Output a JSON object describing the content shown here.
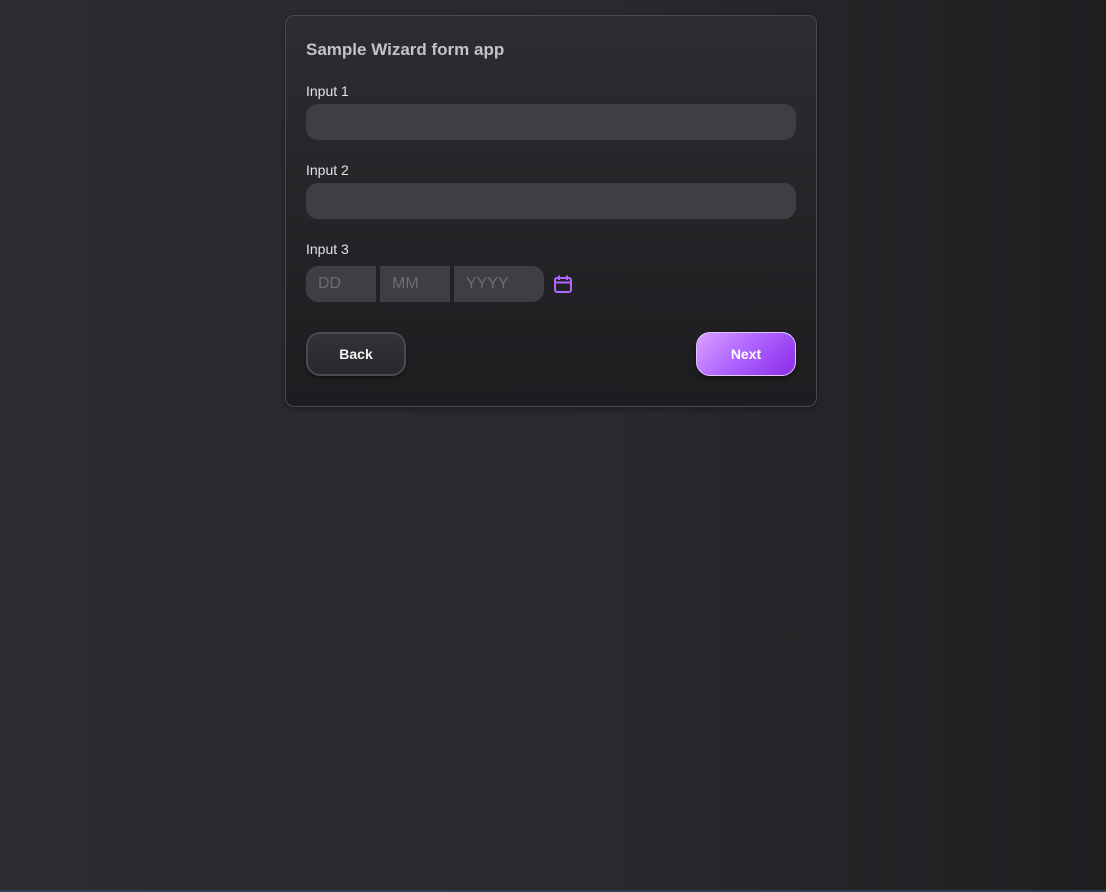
{
  "app": {
    "title": "Sample Wizard form app"
  },
  "form": {
    "input1": {
      "label": "Input 1",
      "value": ""
    },
    "input2": {
      "label": "Input 2",
      "value": ""
    },
    "input3": {
      "label": "Input 3",
      "day_placeholder": "DD",
      "month_placeholder": "MM",
      "year_placeholder": "YYYY",
      "calendar_icon": "calendar-icon"
    }
  },
  "buttons": {
    "back_label": "Back",
    "next_label": "Next"
  },
  "colors": {
    "accent": "#b066ff",
    "accent_dark": "#8a2be8",
    "background": "#2a292d",
    "input_bg": "#403d43"
  }
}
